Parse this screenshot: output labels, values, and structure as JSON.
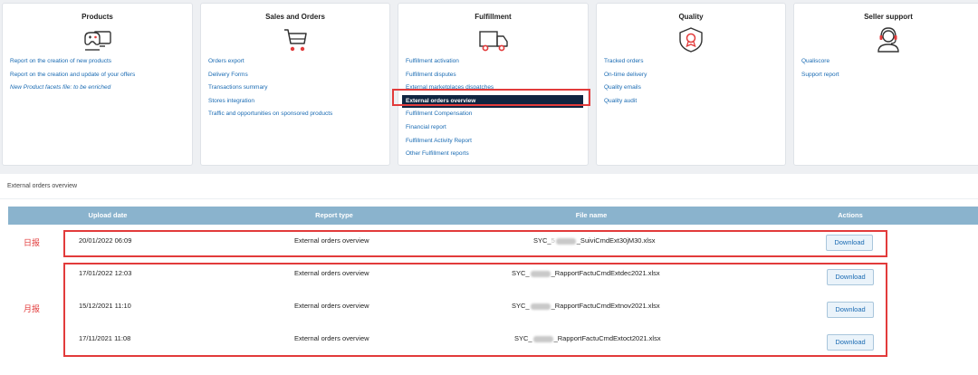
{
  "cards": [
    {
      "title": "Products",
      "icon": "gamepad-computer-icon",
      "links": [
        "Report on the creation of new products",
        "Report on the creation and update of your offers",
        "New Product facets file: to be enriched"
      ]
    },
    {
      "title": "Sales and Orders",
      "icon": "shopping-cart-icon",
      "links": [
        "Orders export",
        "Delivery Forms",
        "Transactions summary",
        "Stores integration",
        "Traffic and opportunities on sponsored products"
      ]
    },
    {
      "title": "Fulfillment",
      "icon": "delivery-truck-icon",
      "links": [
        "Fulfillment activation",
        "Fulfillment disputes",
        "External marketplaces dispatches",
        "External orders overview",
        "Fulfillment Compensation",
        "Financial report",
        "Fulfillment Activity Report",
        "Other Fulfillment reports"
      ],
      "active_link": "External orders overview"
    },
    {
      "title": "Quality",
      "icon": "quality-badge-icon",
      "links": [
        "Tracked orders",
        "On-time delivery",
        "Quality emails",
        "Quality audit"
      ]
    },
    {
      "title": "Seller support",
      "icon": "headset-support-icon",
      "links": [
        "Qualiscore",
        "Support report"
      ]
    }
  ],
  "section_title": "External orders overview",
  "table": {
    "headers": [
      "Upload date",
      "Report type",
      "File name",
      "Actions"
    ],
    "rows": [
      {
        "date": "20/01/2022 06:09",
        "type": "External orders overview",
        "file_prefix": "SYC_",
        "file_mid": "5",
        "file_suffix": "_SuiviCmdExt30jM30.xlsx",
        "action": "Download"
      },
      {
        "date": "17/01/2022 12:03",
        "type": "External orders overview",
        "file_prefix": "SYC_",
        "file_mid": "",
        "file_suffix": "_RapportFactuCmdExtdec2021.xlsx",
        "action": "Download"
      },
      {
        "date": "15/12/2021 11:10",
        "type": "External orders overview",
        "file_prefix": "SYC_",
        "file_mid": "",
        "file_suffix": "_RapportFactuCmdExtnov2021.xlsx",
        "action": "Download"
      },
      {
        "date": "17/11/2021 11:08",
        "type": "External orders overview",
        "file_prefix": "SYC_",
        "file_mid": "",
        "file_suffix": "_RapportFactuCmdExtoct2021.xlsx",
        "action": "Download"
      }
    ]
  },
  "annotations": {
    "daily": "日报",
    "monthly": "月报"
  },
  "colors": {
    "link": "#1a6bb3",
    "active_bg": "#0f2541",
    "header_bg": "#8ab3cd",
    "annotation": "#e23b3b"
  }
}
